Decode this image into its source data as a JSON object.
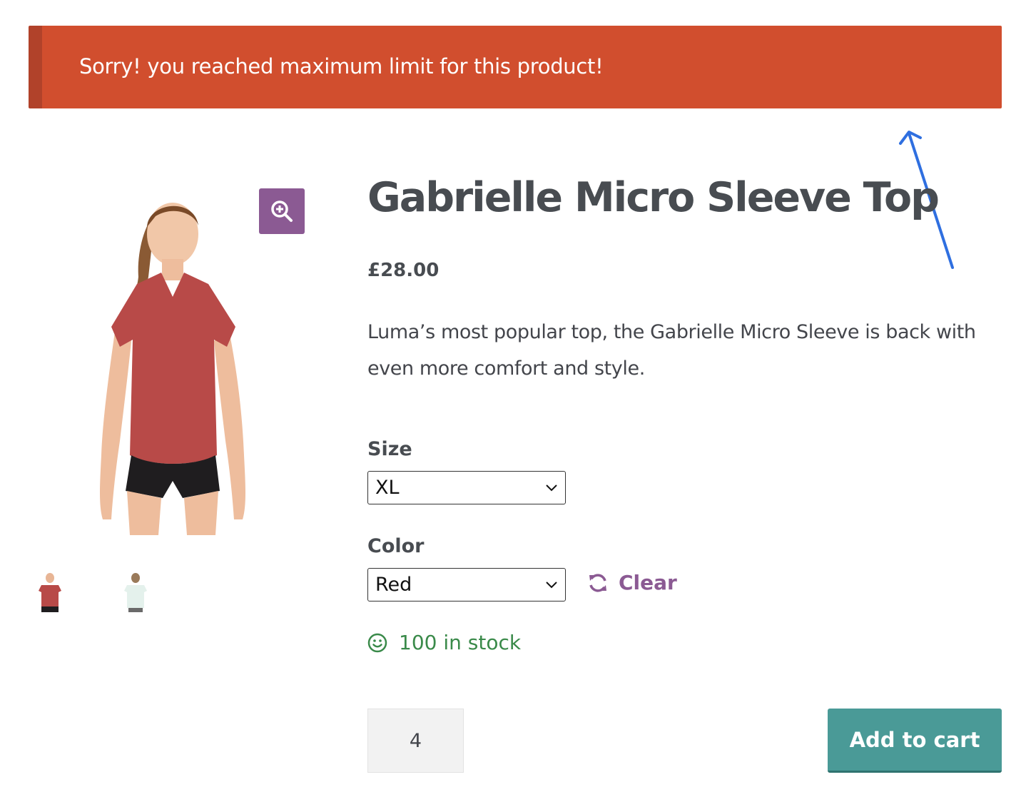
{
  "notice": {
    "message": "Sorry! you reached maximum limit for this product!",
    "color": "#d14e2e"
  },
  "gallery": {
    "zoom_icon": "zoom-in-icon",
    "thumbnails": [
      "red-top-thumbnail",
      "white-top-thumbnail"
    ]
  },
  "product": {
    "title": "Gabrielle Micro Sleeve Top",
    "price": "£28.00",
    "description": "Luma’s most popular top, the Gabrielle Micro Sleeve is back with even more comfort and style."
  },
  "attributes": {
    "size": {
      "label": "Size",
      "value": "XL"
    },
    "color": {
      "label": "Color",
      "value": "Red"
    },
    "clear_label": "Clear",
    "clear_icon": "refresh-icon"
  },
  "stock": {
    "text": "100 in stock",
    "icon": "smiley-icon",
    "color": "#3a8a4a"
  },
  "cart": {
    "quantity": "4",
    "button_label": "Add to cart",
    "button_color": "#4a9a97"
  },
  "accent_color": "#8b5a93"
}
